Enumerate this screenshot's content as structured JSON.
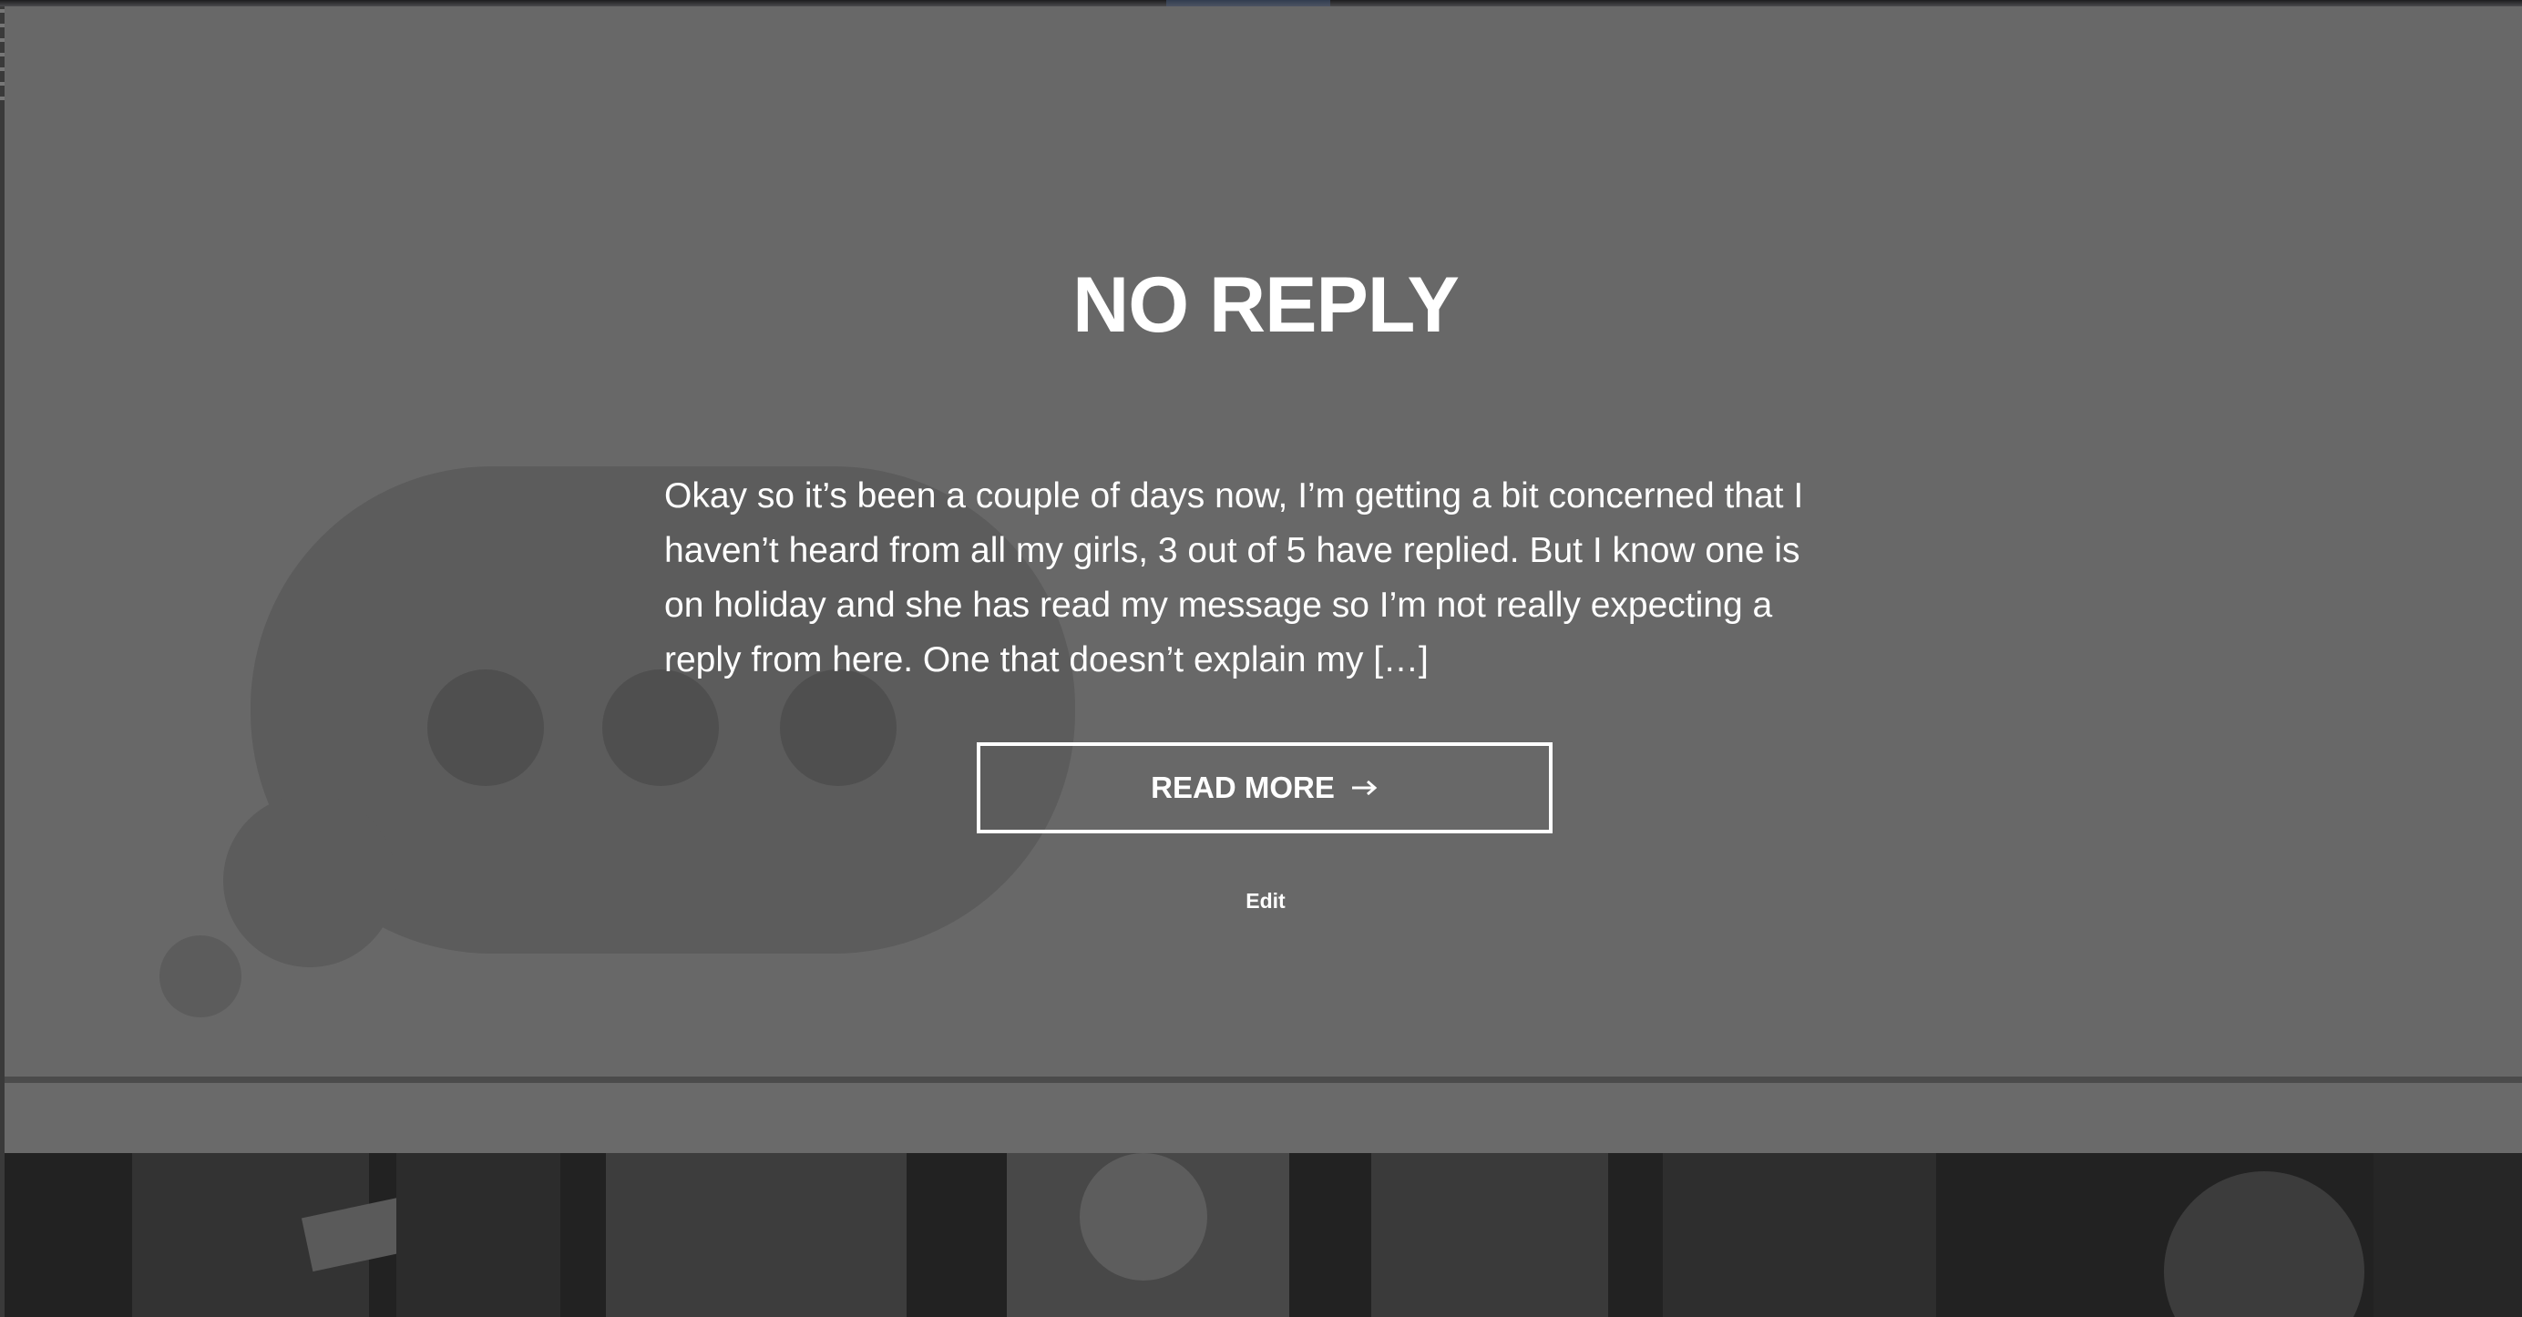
{
  "post": {
    "title": "NO REPLY",
    "excerpt": "Okay so it’s been a couple of days now, I’m getting a bit concerned that I haven’t heard from all my girls, 3 out of 5 have replied. But I know one is on holiday and she has read my message so I’m not really expecting a reply from here. One that doesn’t explain my […]",
    "read_more_label": "READ MORE",
    "read_more_icon": "arrow-right-icon",
    "edit_label": "Edit",
    "background_icon": "speech-bubble-icon"
  },
  "colors": {
    "hero_background": "#686868",
    "text": "#ffffff",
    "bubble": "#5b5b5b",
    "bubble_dots": "#4e4e4e"
  }
}
